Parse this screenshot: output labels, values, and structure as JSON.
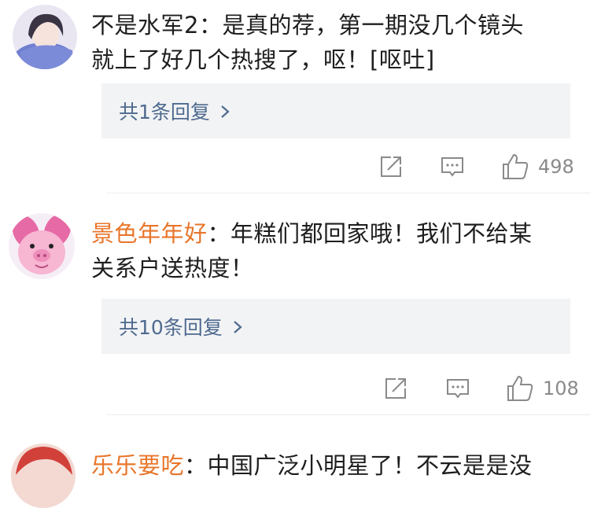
{
  "comments": [
    {
      "author": "不是水军2",
      "separator": "：",
      "text_line1": "是真的荐，第一期没几个镜头",
      "text_line2": "就上了好几个热搜了，呕！[呕吐]",
      "reply_label": "共1条回复",
      "likes": "498"
    },
    {
      "author": "景色年年好",
      "separator": "：",
      "text_line1": "年糕们都回家哦！我们不给某",
      "text_line2": "关系户送热度！",
      "reply_label": "共10条回复",
      "likes": "108"
    },
    {
      "author": "乐乐要吃",
      "separator": "：",
      "text_line1": "中国广泛小明星了！不云是是没"
    }
  ],
  "icons": [
    "share-icon",
    "comment-icon",
    "like-icon",
    "chevron-right-icon"
  ],
  "colors": {
    "author_accent": "#e8762b",
    "reply_link": "#4e6a8f",
    "reply_bg": "#f2f3f5",
    "muted": "#8a8a8a"
  }
}
